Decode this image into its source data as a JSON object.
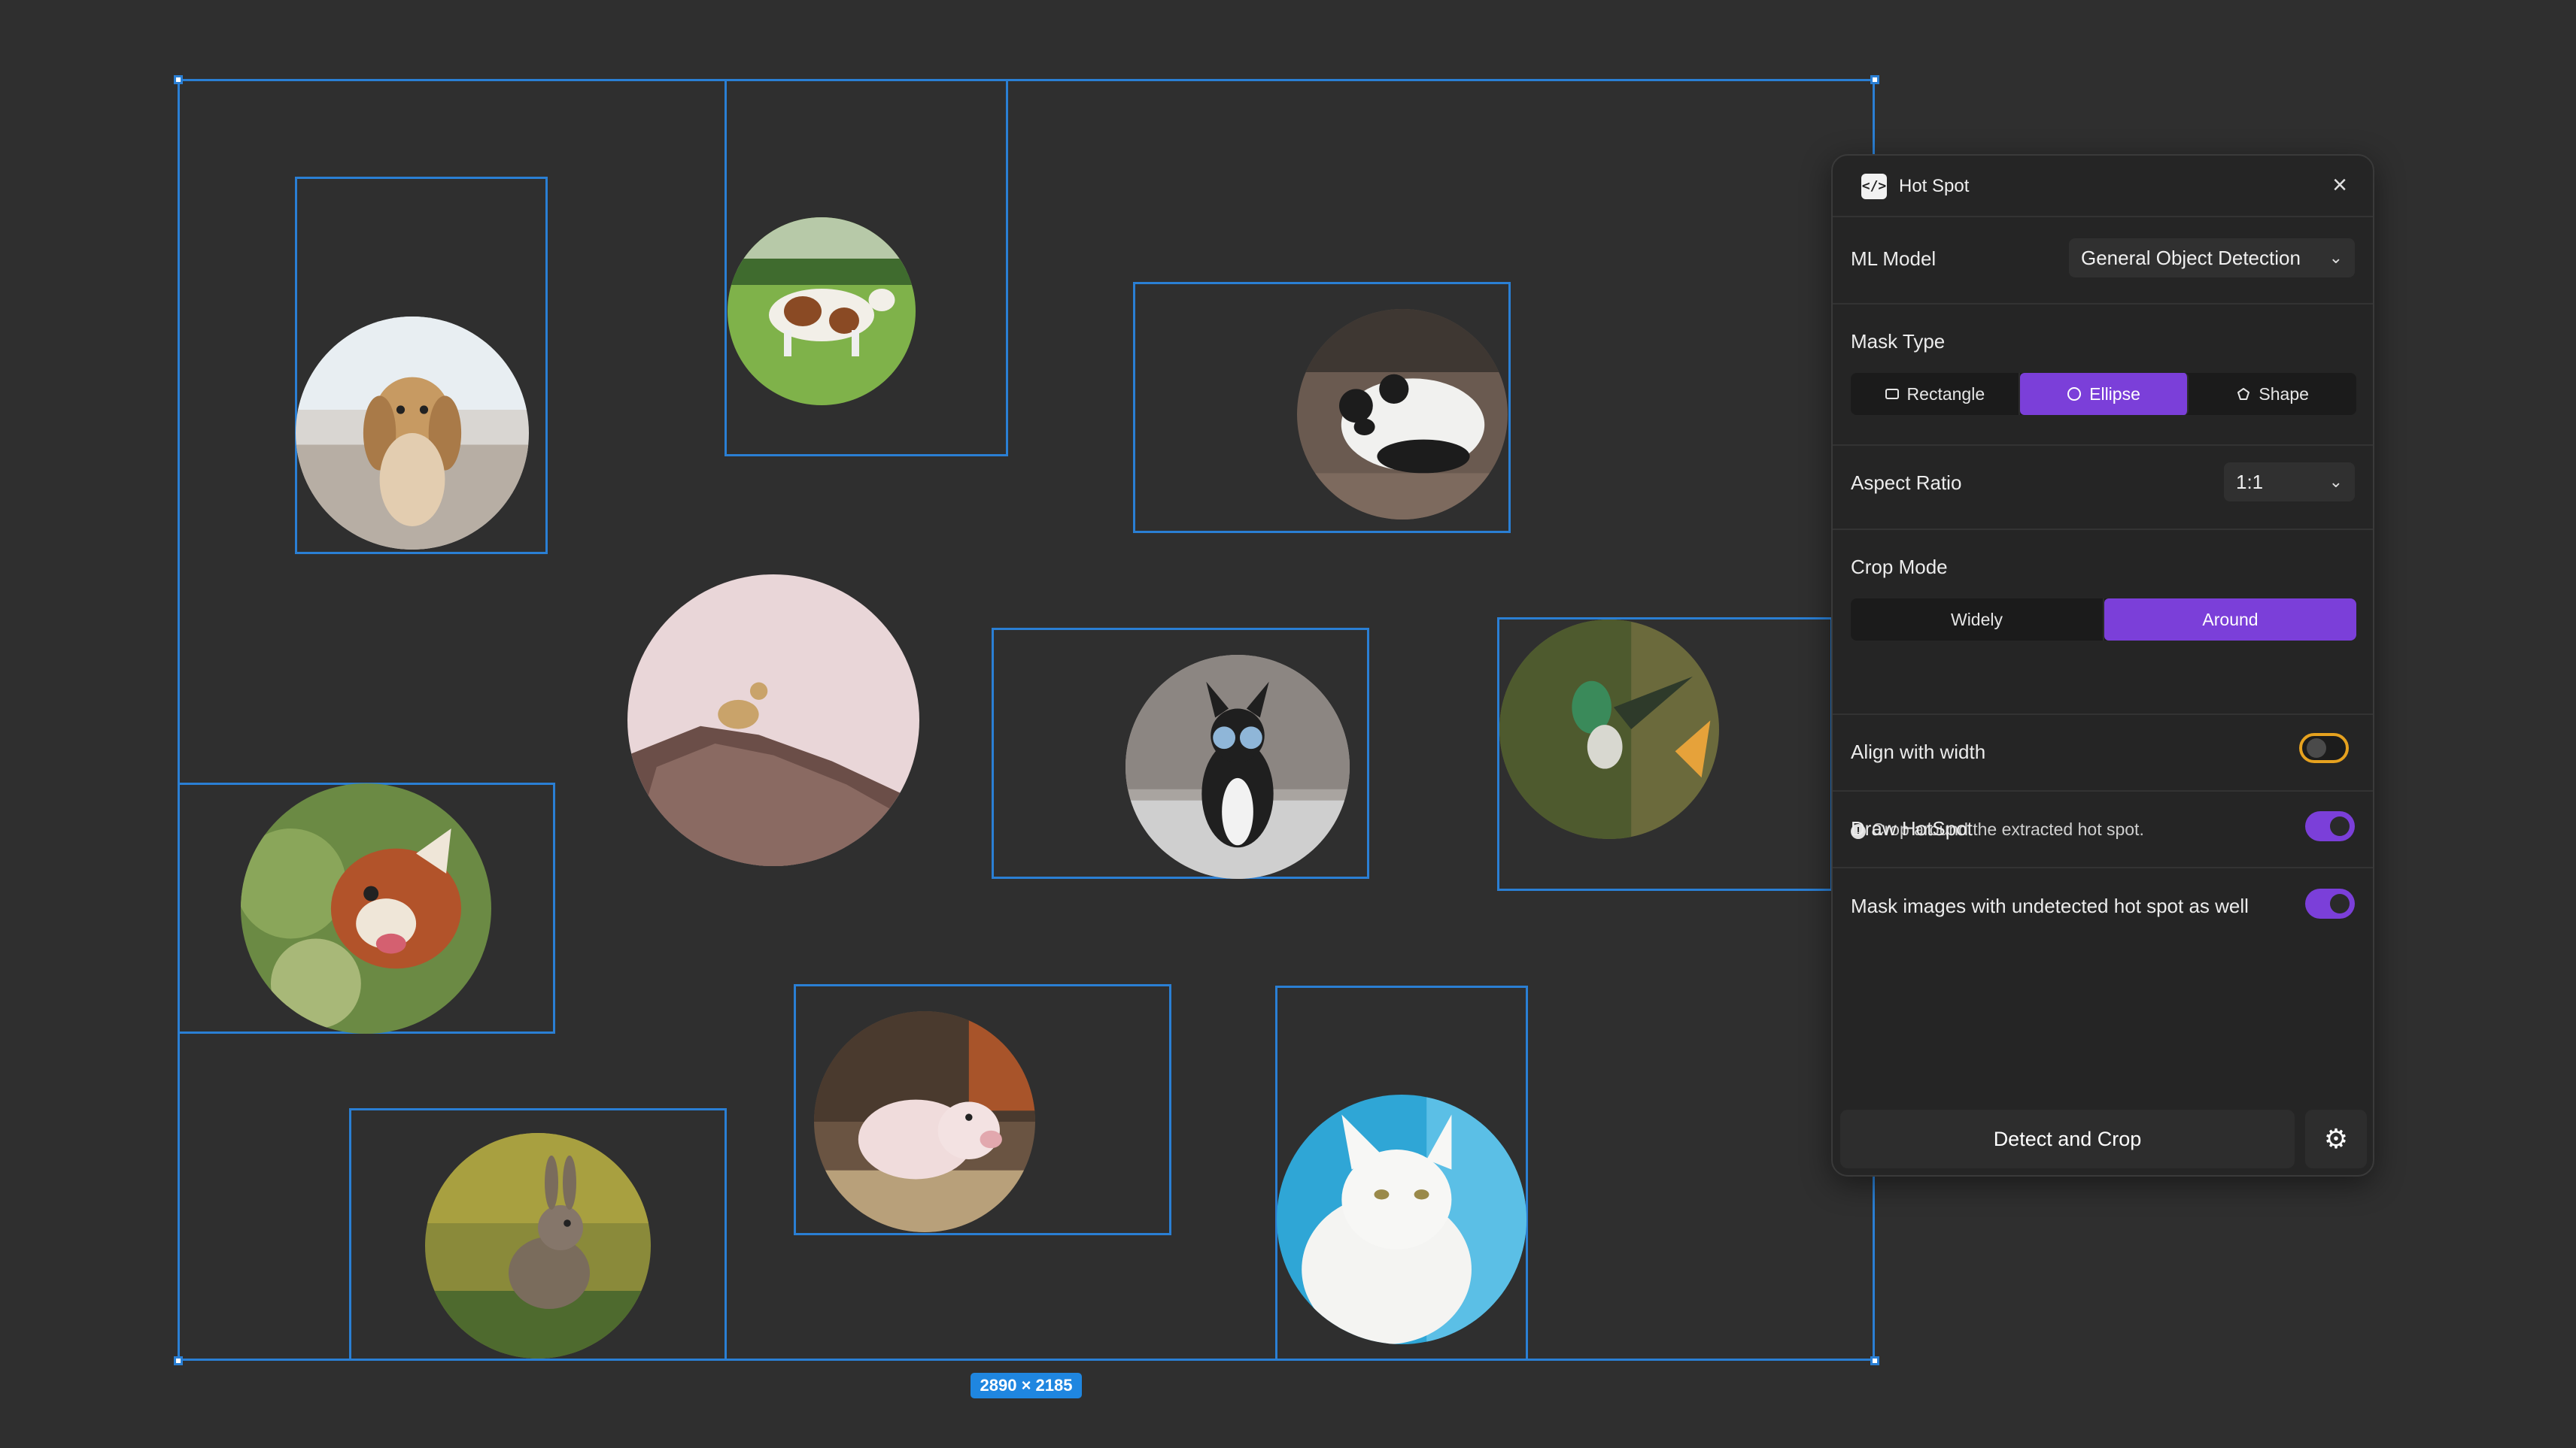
{
  "canvas": {
    "dimensions_label": "2890 × 2185",
    "photos": [
      {
        "subject": "spaniel puppy on beach"
      },
      {
        "subject": "cow in field"
      },
      {
        "subject": "panda cub"
      },
      {
        "subject": "leopard on rock"
      },
      {
        "subject": "boston terrier with goggles"
      },
      {
        "subject": "hummingbird"
      },
      {
        "subject": "red panda"
      },
      {
        "subject": "piglet"
      },
      {
        "subject": "rabbit in grass"
      },
      {
        "subject": "white cat"
      }
    ]
  },
  "panel": {
    "title": "Hot Spot",
    "app_icon_glyph": "</>",
    "close_icon": "×",
    "ml_model": {
      "label": "ML Model",
      "value": "General Object Detection"
    },
    "mask_type": {
      "label": "Mask Type",
      "options": [
        {
          "label": "Rectangle",
          "icon": "rectangle-icon",
          "active": false
        },
        {
          "label": "Ellipse",
          "icon": "ellipse-icon",
          "active": true
        },
        {
          "label": "Shape",
          "icon": "shape-icon",
          "active": false
        }
      ]
    },
    "aspect_ratio": {
      "label": "Aspect Ratio",
      "value": "1:1"
    },
    "crop_mode": {
      "label": "Crop Mode",
      "options": [
        {
          "label": "Widely",
          "active": false
        },
        {
          "label": "Around",
          "active": true
        }
      ],
      "hint": "Crop around the extracted hot spot."
    },
    "toggles": [
      {
        "label": "Align with width",
        "on": false
      },
      {
        "label": "Draw HotSpot",
        "on": true
      },
      {
        "label": "Mask images with undetected hot spot as well",
        "on": true
      }
    ],
    "primary_button": "Detect and Crop",
    "settings_icon": "⚙"
  },
  "colors": {
    "accent": "#7b3fd9",
    "selection": "#2a7fd4",
    "focus_ring": "#e6a21f",
    "background": "#2f2f2f"
  }
}
